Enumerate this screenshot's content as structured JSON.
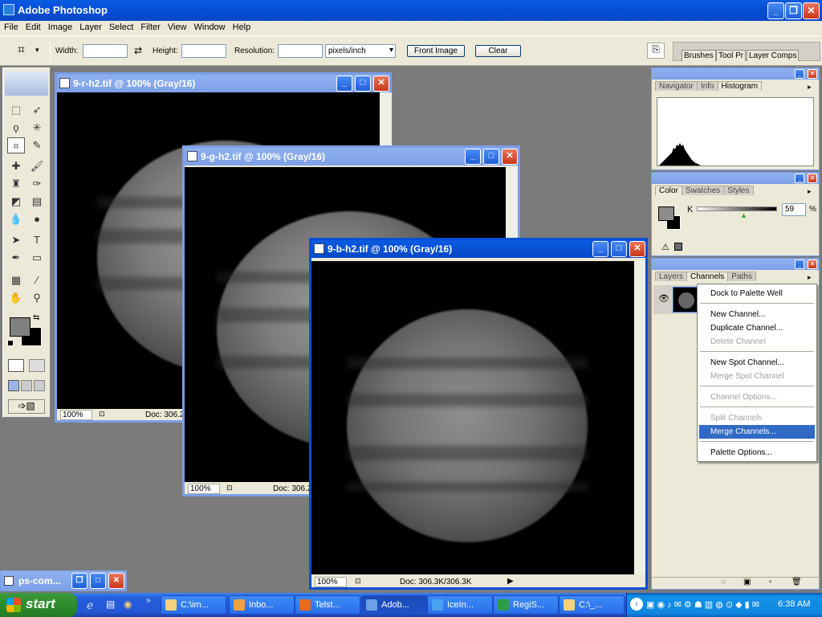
{
  "app": {
    "title": "Adobe Photoshop"
  },
  "menu": [
    "File",
    "Edit",
    "Image",
    "Layer",
    "Select",
    "Filter",
    "View",
    "Window",
    "Help"
  ],
  "options": {
    "width_label": "Width:",
    "width_value": "",
    "height_label": "Height:",
    "height_value": "",
    "resolution_label": "Resolution:",
    "resolution_value": "",
    "units": "pixels/inch",
    "front_image": "Front Image",
    "clear": "Clear"
  },
  "well_tabs": [
    "Brushes",
    "Tool Pr",
    "Layer Comps"
  ],
  "docs": [
    {
      "title": "9-r-h2.tif @ 100% (Gray/16)",
      "zoom": "100%",
      "doc_info": "Doc: 306.2"
    },
    {
      "title": "9-g-h2.tif @ 100% (Gray/16)",
      "zoom": "100%",
      "doc_info": "Doc: 306.2"
    },
    {
      "title": "9-b-h2.tif @ 100% (Gray/16)",
      "zoom": "100%",
      "doc_info": "Doc: 306.3K/306.3K"
    }
  ],
  "panels": {
    "navigator": {
      "tabs": [
        "Navigator",
        "Info",
        "Histogram"
      ]
    },
    "color": {
      "tabs": [
        "Color",
        "Swatches",
        "Styles"
      ],
      "channel_label": "K",
      "value": "59",
      "unit": "%"
    },
    "layers": {
      "tabs": [
        "Layers",
        "Channels",
        "Paths"
      ]
    }
  },
  "context_menu": {
    "items": [
      {
        "label": "Dock to Palette Well",
        "enabled": true
      },
      {
        "label": "New Channel...",
        "enabled": true
      },
      {
        "label": "Duplicate Channel...",
        "enabled": true
      },
      {
        "label": "Delete Channel",
        "enabled": false
      },
      {
        "label": "New Spot Channel...",
        "enabled": true
      },
      {
        "label": "Merge Spot Channel",
        "enabled": false
      },
      {
        "label": "Channel Options...",
        "enabled": false
      },
      {
        "label": "Split Channels",
        "enabled": false
      },
      {
        "label": "Merge Channels...",
        "enabled": true,
        "highlighted": true
      },
      {
        "label": "Palette Options...",
        "enabled": true
      }
    ]
  },
  "minimized": {
    "title": "ps-com..."
  },
  "taskbar": {
    "start": "start",
    "buttons": [
      "C:\\im...",
      "Inbo...",
      "Telst...",
      "Adob...",
      "IceIn...",
      "RegiS...",
      "C:\\_..."
    ],
    "clock": "6:38 AM"
  },
  "colors": {
    "title_active": "#0a5be3",
    "title_inactive": "#7ea0e8",
    "highlight": "#316ac5"
  }
}
